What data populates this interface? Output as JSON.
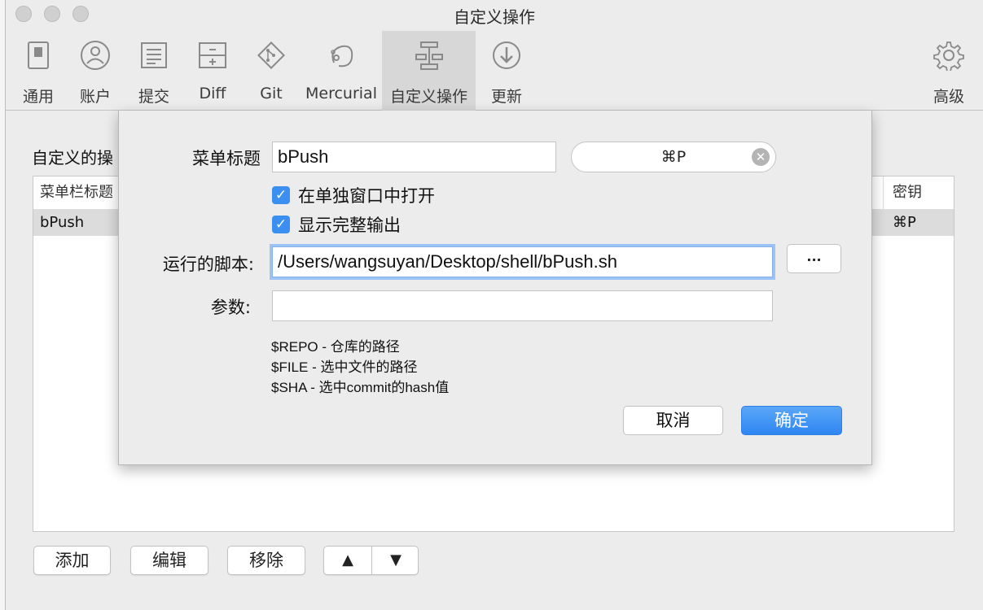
{
  "window": {
    "title": "自定义操作"
  },
  "toolbar": {
    "items": [
      {
        "label": "通用",
        "icon": "switch-icon"
      },
      {
        "label": "账户",
        "icon": "account-icon"
      },
      {
        "label": "提交",
        "icon": "commit-icon"
      },
      {
        "label": "Diff",
        "icon": "diff-icon"
      },
      {
        "label": "Git",
        "icon": "git-icon"
      },
      {
        "label": "Mercurial",
        "icon": "mercurial-icon"
      },
      {
        "label": "自定义操作",
        "icon": "custom-actions-icon",
        "active": true
      },
      {
        "label": "更新",
        "icon": "update-icon"
      },
      {
        "label": "高级",
        "icon": "gear-icon"
      }
    ]
  },
  "main": {
    "section_title": "自定义的操",
    "table": {
      "columns": [
        "菜单栏标题",
        "密钥"
      ],
      "rows": [
        {
          "title": "bPush",
          "key": "⌘P"
        }
      ]
    },
    "buttons": {
      "add": "添加",
      "edit": "编辑",
      "remove": "移除",
      "up": "▲",
      "down": "▼"
    }
  },
  "dialog": {
    "menu_title_label": "菜单标题",
    "menu_title_value": "bPush",
    "shortcut_value": "⌘P",
    "open_separate_window": "在单独窗口中打开",
    "show_full_output": "显示完整输出",
    "script_label": "运行的脚本:",
    "script_value": "/Users/wangsuyan/Desktop/shell/bPush.sh",
    "browse_label": "...",
    "params_label": "参数:",
    "params_value": "",
    "hints": [
      "$REPO - 仓库的路径",
      "$FILE - 选中文件的路径",
      "$SHA - 选中commit的hash值"
    ],
    "cancel_label": "取消",
    "ok_label": "确定"
  },
  "colors": {
    "accent": "#3b8ff0",
    "selection": "#dcdcdc"
  }
}
